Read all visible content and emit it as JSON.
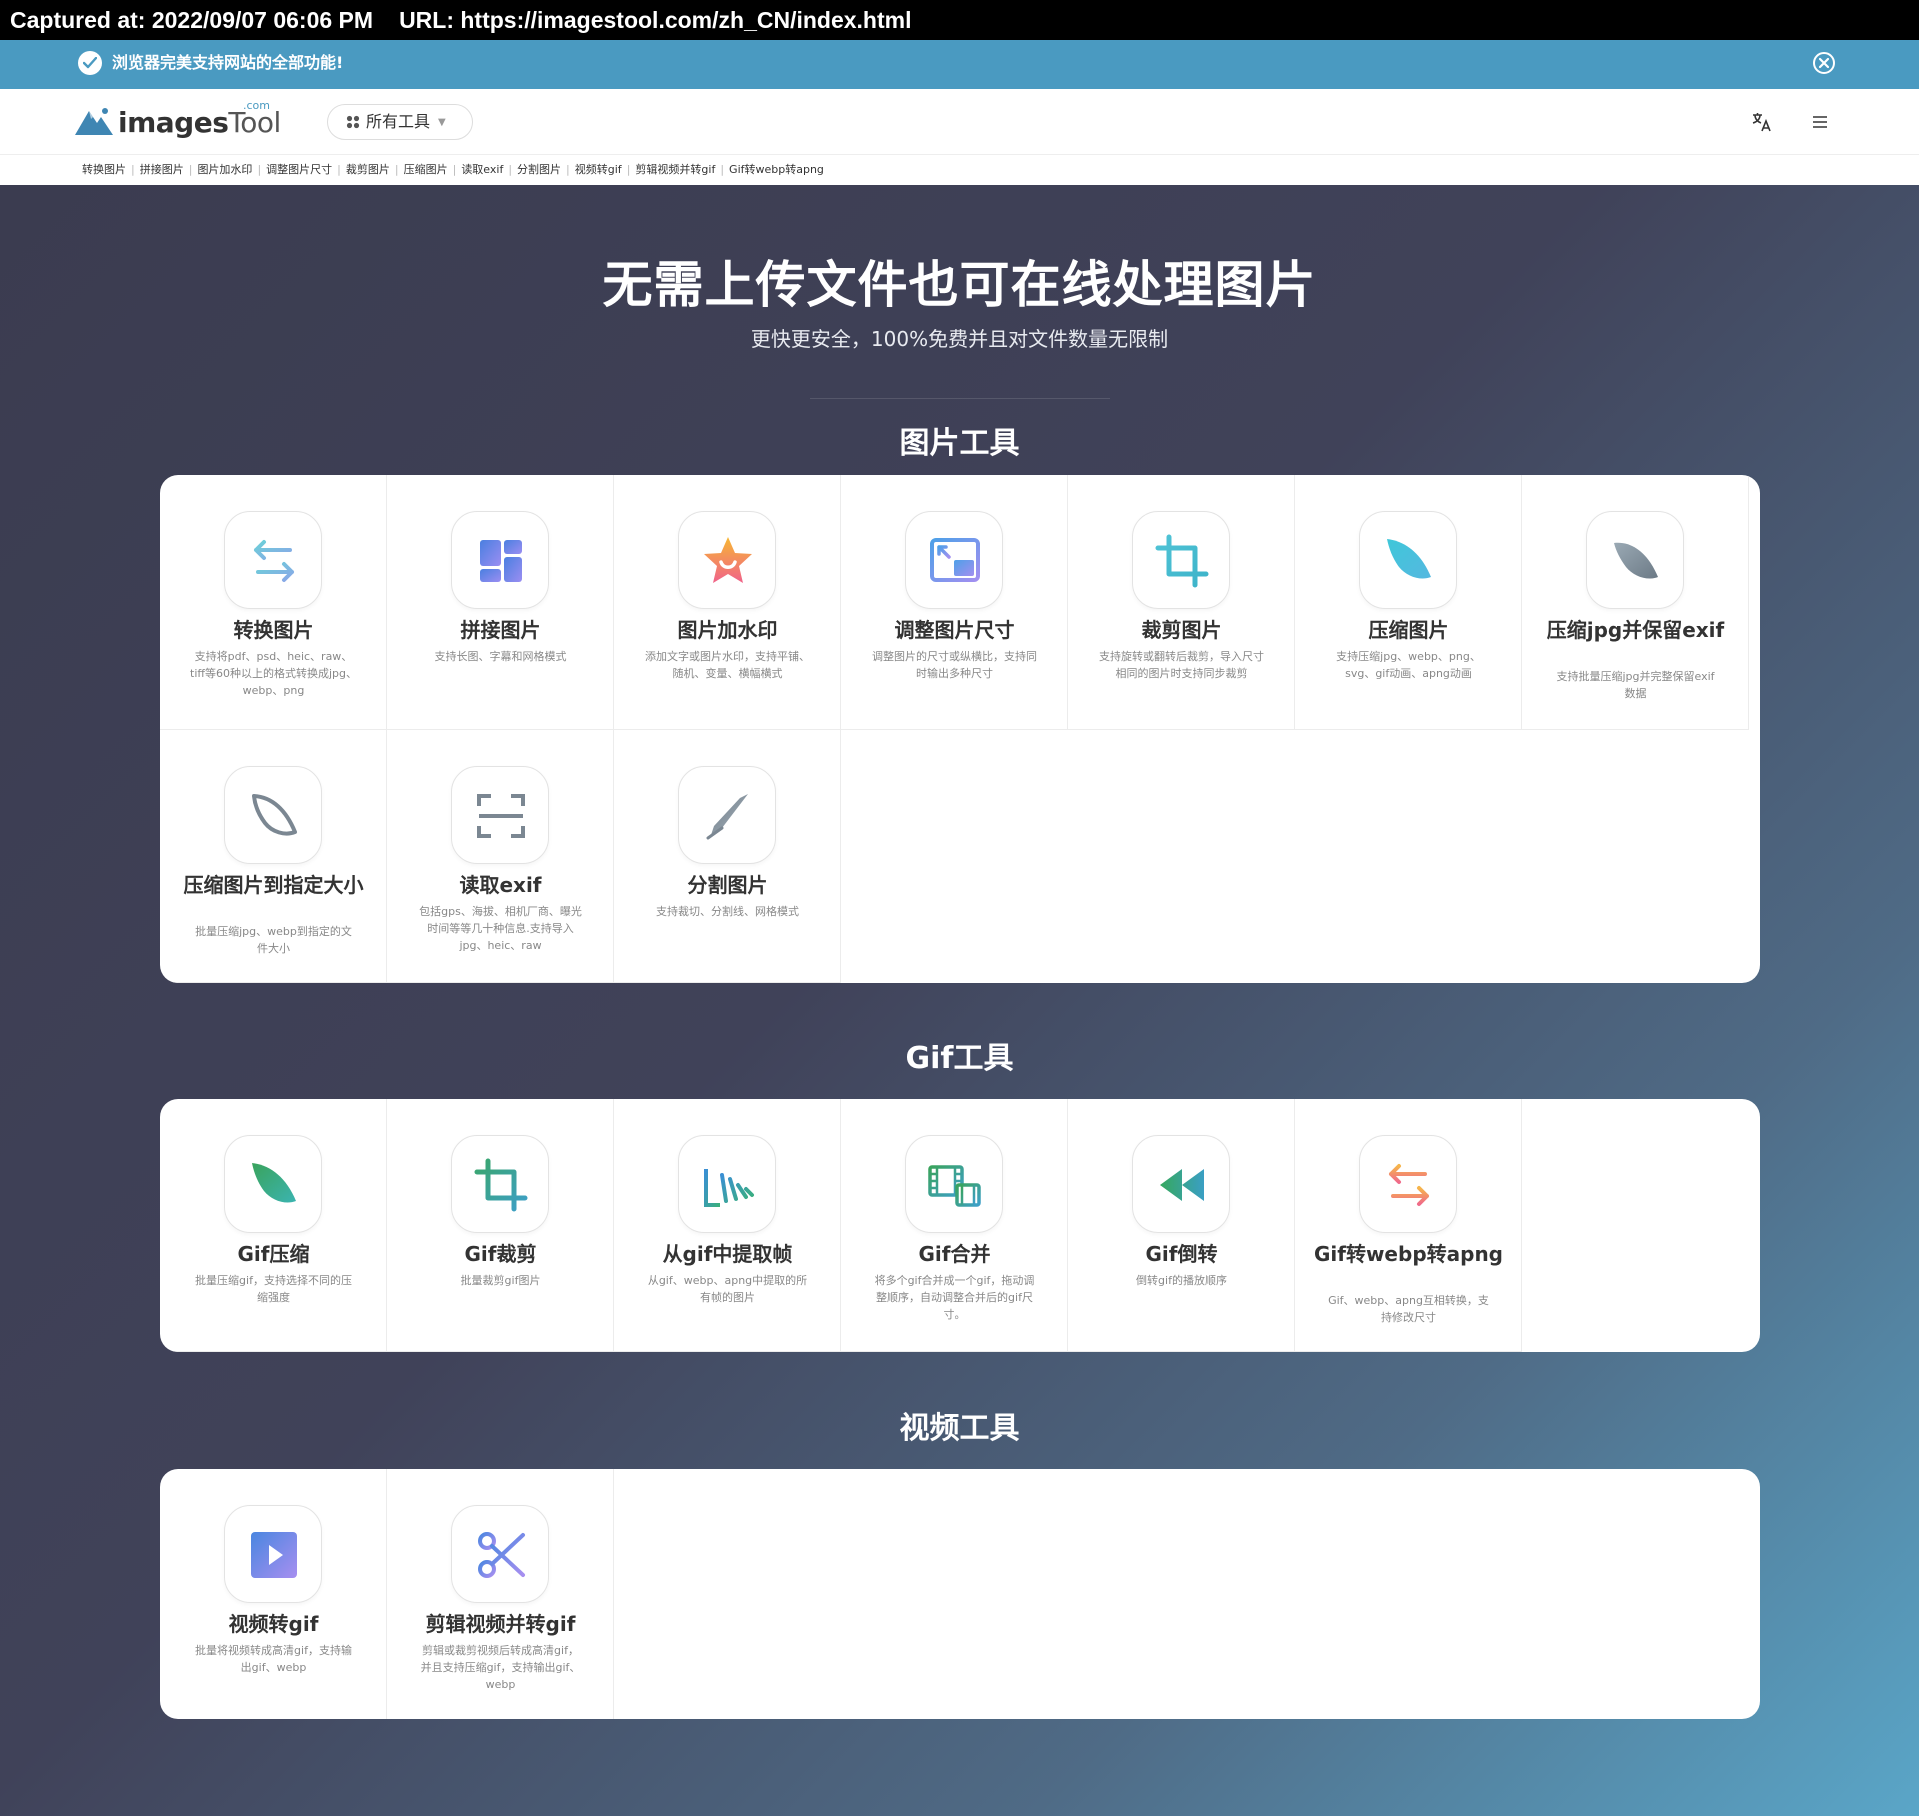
{
  "capture": {
    "captured_at": "Captured at: 2022/09/07 06:06 PM",
    "url": "URL: https://imagestool.com/zh_CN/index.html"
  },
  "notice": {
    "message": "浏览器完美支持网站的全部功能!",
    "icon": "check-circle-icon",
    "close_icon": "close-circle-icon"
  },
  "header": {
    "logo_text_bold": "images",
    "logo_text_light": "Tool",
    "logo_com": ".com",
    "all_tools": "所有工具",
    "lang_icon": "translate-icon",
    "menu_icon": "hamburger-menu-icon"
  },
  "quick_links": [
    "转换图片",
    "拼接图片",
    "图片加水印",
    "调整图片尺寸",
    "裁剪图片",
    "压缩图片",
    "读取exif",
    "分割图片",
    "视频转gif",
    "剪辑视频并转gif",
    "Gif转webp转apng"
  ],
  "hero": {
    "title": "无需上传文件也可在线处理图片",
    "subtitle": "更快更安全，100%免费并且对文件数量无限制"
  },
  "sections": {
    "image_tools": {
      "title": "图片工具",
      "tools": [
        {
          "title": "转换图片",
          "desc": "支持将pdf、psd、heic、raw、tiff等60种以上的格式转换成jpg、webp、png",
          "icon": "convert-arrows-icon"
        },
        {
          "title": "拼接图片",
          "desc": "支持长图、字幕和网格模式",
          "icon": "grid-layout-icon"
        },
        {
          "title": "图片加水印",
          "desc": "添加文字或图片水印，支持平铺、随机、变量、横幅横式",
          "icon": "star-icon"
        },
        {
          "title": "调整图片尺寸",
          "desc": "调整图片的尺寸或纵横比，支持同时输出多种尺寸",
          "icon": "resize-icon"
        },
        {
          "title": "裁剪图片",
          "desc": "支持旋转或翻转后裁剪，导入尺寸相同的图片时支持同步裁剪",
          "icon": "crop-icon"
        },
        {
          "title": "压缩图片",
          "desc": "支持压缩jpg、webp、png、svg、gif动画、apng动画",
          "icon": "leaf-icon"
        },
        {
          "title": "压缩jpg并保留exif",
          "desc": "支持批量压缩jpg并完整保留exif数据",
          "icon": "leaf-gray-icon"
        },
        {
          "title": "压缩图片到指定大小",
          "desc": "批量压缩jpg、webp到指定的文件大小",
          "icon": "leaf-outline-icon"
        },
        {
          "title": "读取exif",
          "desc": "包括gps、海拔、相机厂商、曝光时间等等几十种信息.支持导入jpg、heic、raw",
          "icon": "scan-icon"
        },
        {
          "title": "分割图片",
          "desc": "支持裁切、分割线、网格模式",
          "icon": "knife-icon"
        }
      ]
    },
    "gif_tools": {
      "title": "Gif工具",
      "tools": [
        {
          "title": "Gif压缩",
          "desc": "批量压缩gif，支持选择不同的压缩强度",
          "icon": "leaf-green-icon"
        },
        {
          "title": "Gif裁剪",
          "desc": "批量裁剪gif图片",
          "icon": "crop-green-icon"
        },
        {
          "title": "从gif中提取帧",
          "desc": "从gif、webp、apng中提取的所有帧的图片",
          "icon": "extract-frames-icon"
        },
        {
          "title": "Gif合并",
          "desc": "将多个gif合并成一个gif，拖动调整顺序，自动调整合并后的gif尺寸。",
          "icon": "film-merge-icon"
        },
        {
          "title": "Gif倒转",
          "desc": "倒转gif的播放顺序",
          "icon": "rewind-icon"
        },
        {
          "title": "Gif转webp转apng",
          "desc": "Gif、webp、apng互相转换，支持修改尺寸",
          "icon": "convert-orange-icon"
        }
      ]
    },
    "video_tools": {
      "title": "视频工具",
      "tools": [
        {
          "title": "视频转gif",
          "desc": "批量将视频转成高清gif，支持输出gif、webp",
          "icon": "play-icon"
        },
        {
          "title": "剪辑视频并转gif",
          "desc": "剪辑或裁剪视频后转成高清gif，并且支持压缩gif，支持输出gif、webp",
          "icon": "scissors-icon"
        }
      ]
    }
  }
}
